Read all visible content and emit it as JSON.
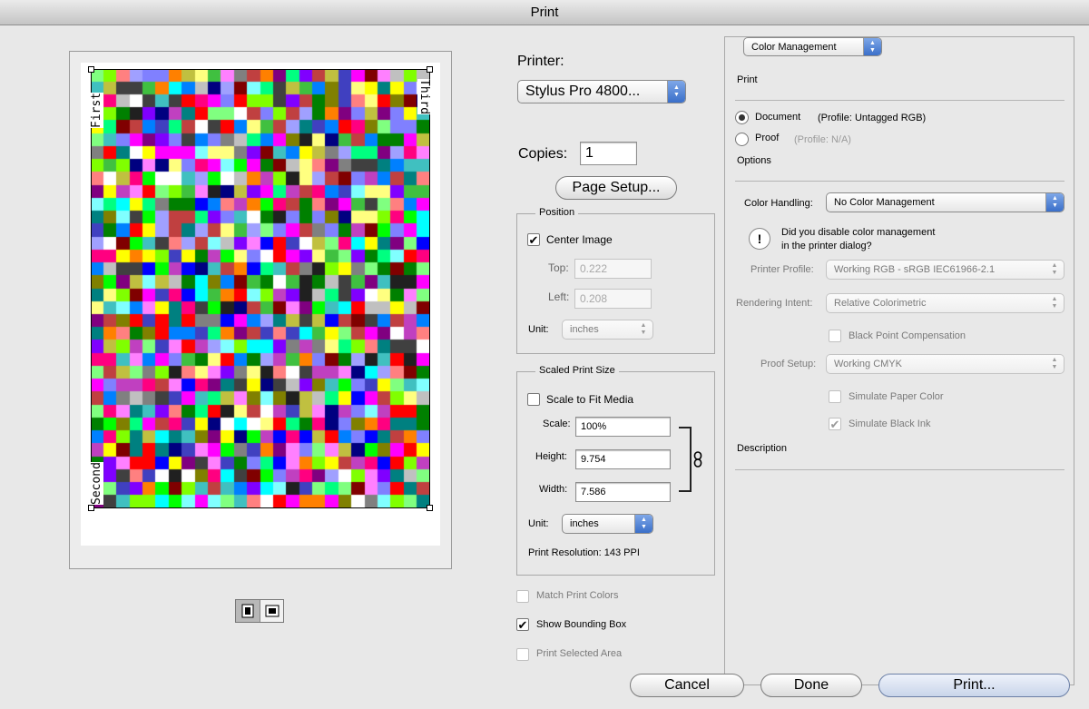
{
  "window": {
    "title": "Print"
  },
  "preview": {
    "labels": {
      "first": "First",
      "second": "Second",
      "third": "Third"
    },
    "view_buttons": [
      {
        "icon": "portrait-icon",
        "glyph": "⬚"
      },
      {
        "icon": "landscape-icon",
        "glyph": "⬕"
      }
    ]
  },
  "printer": {
    "label": "Printer:",
    "value": "Stylus Pro 4800..."
  },
  "copies": {
    "label": "Copies:",
    "value": "1"
  },
  "page_setup": {
    "label": "Page Setup..."
  },
  "position": {
    "title": "Position",
    "center_image": {
      "label": "Center Image",
      "checked": true
    },
    "top": {
      "label": "Top:",
      "value": "0.222"
    },
    "left": {
      "label": "Left:",
      "value": "0.208"
    },
    "unit": {
      "label": "Unit:",
      "value": "inches"
    }
  },
  "scaled_print_size": {
    "title": "Scaled Print Size",
    "scale_to_fit": {
      "label": "Scale to Fit Media",
      "checked": false
    },
    "scale": {
      "label": "Scale:",
      "value": "100%"
    },
    "height": {
      "label": "Height:",
      "value": "9.754"
    },
    "width": {
      "label": "Width:",
      "value": "7.586"
    },
    "unit": {
      "label": "Unit:",
      "value": "inches"
    },
    "resolution": "Print Resolution: 143 PPI"
  },
  "options_left": {
    "match_print_colors": {
      "label": "Match Print Colors",
      "checked": false
    },
    "show_bounding_box": {
      "label": "Show Bounding Box",
      "checked": true
    },
    "print_selected_area": {
      "label": "Print Selected Area",
      "checked": false
    }
  },
  "right": {
    "mode_popup": "Color Management",
    "print_section": "Print",
    "document": {
      "label": "Document",
      "profile": "(Profile: Untagged RGB)",
      "selected": true
    },
    "proof": {
      "label": "Proof",
      "profile": "(Profile: N/A)",
      "selected": false
    },
    "options_section": "Options",
    "color_handling": {
      "label": "Color Handling:",
      "value": "No Color Management"
    },
    "warning": {
      "line1": "Did you disable color management",
      "line2": "in the printer dialog?"
    },
    "printer_profile": {
      "label": "Printer Profile:",
      "value": "Working RGB - sRGB IEC61966-2.1"
    },
    "rendering_intent": {
      "label": "Rendering Intent:",
      "value": "Relative Colorimetric"
    },
    "black_point": {
      "label": "Black Point Compensation",
      "checked": false
    },
    "proof_setup": {
      "label": "Proof Setup:",
      "value": "Working CMYK"
    },
    "simulate_paper": {
      "label": "Simulate Paper Color",
      "checked": false
    },
    "simulate_black": {
      "label": "Simulate Black Ink",
      "checked": true
    },
    "description_section": "Description"
  },
  "buttons": {
    "cancel": "Cancel",
    "done": "Done",
    "print": "Print..."
  },
  "colors": {
    "accent": "#3a6fc9",
    "mosaic": [
      "#ff0000",
      "#00ff00",
      "#0000ff",
      "#ffff00",
      "#ff00ff",
      "#00ffff",
      "#ff8000",
      "#8000ff",
      "#00ff80",
      "#ff0080",
      "#80ff00",
      "#0080ff",
      "#808080",
      "#c0c0c0",
      "#ffffff",
      "#404040",
      "#800000",
      "#008000",
      "#000080",
      "#808000",
      "#800080",
      "#008080",
      "#ff8080",
      "#80ff80",
      "#8080ff",
      "#ffff80",
      "#ff80ff",
      "#80ffff",
      "#c04040",
      "#40c040",
      "#4040c0",
      "#c0c040",
      "#c040c0",
      "#40c0c0",
      "#202020",
      "#a0a0ff"
    ]
  }
}
